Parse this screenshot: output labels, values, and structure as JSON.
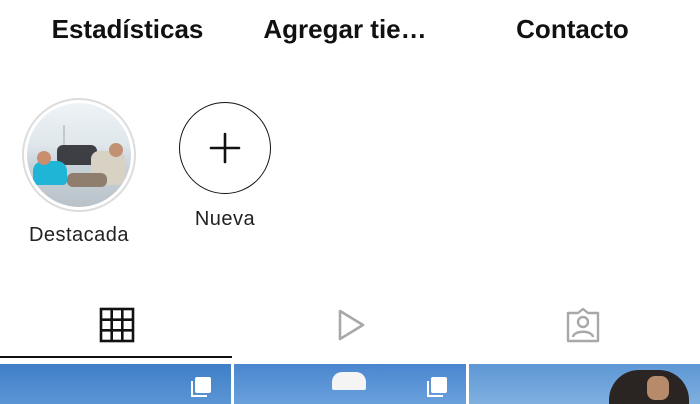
{
  "profile_actions": {
    "stats_label": "Estadísticas",
    "shop_label": "Agregar tie…",
    "contact_label": "Contacto"
  },
  "highlights": [
    {
      "label": "Destacada"
    },
    {
      "label": "Nueva",
      "icon": "plus-icon"
    }
  ],
  "tabs": [
    {
      "icon": "grid-icon",
      "selected": true
    },
    {
      "icon": "reels-play-icon",
      "selected": false
    },
    {
      "icon": "tagged-person-icon",
      "selected": false
    }
  ],
  "colors": {
    "text": "#111111",
    "inactive_icon": "#a8a8a8",
    "active_underline": "#111111"
  }
}
